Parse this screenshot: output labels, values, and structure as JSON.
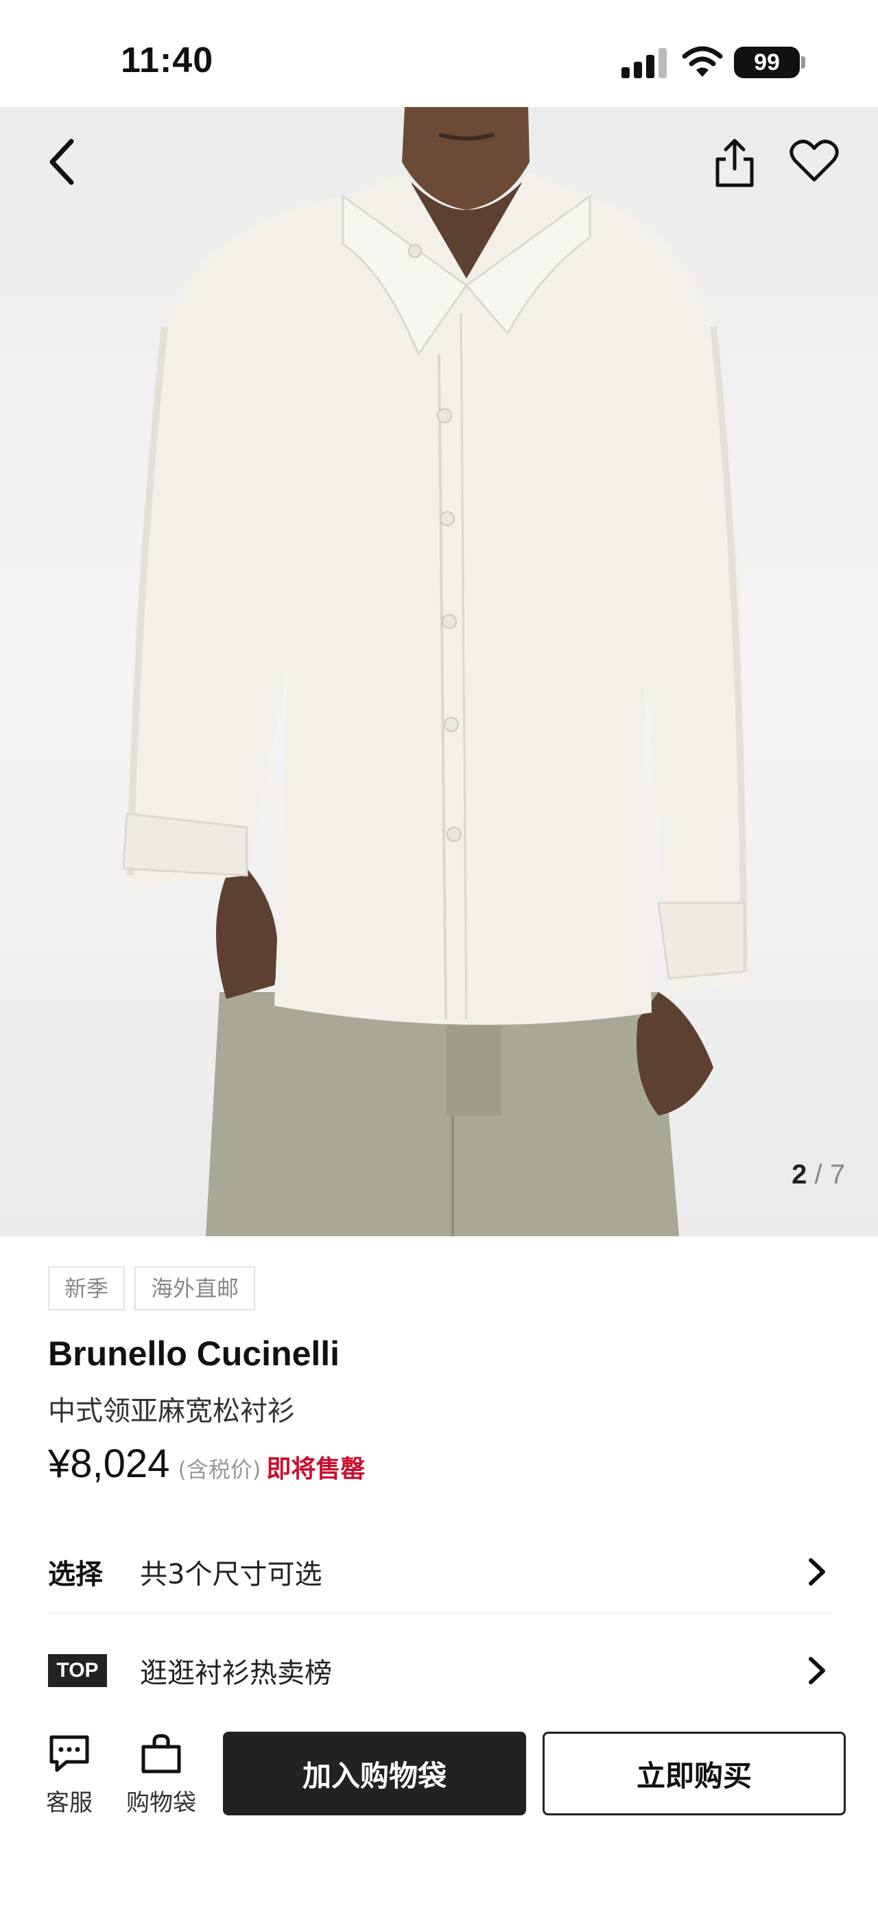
{
  "status_bar": {
    "time": "11:40",
    "battery": "99"
  },
  "gallery": {
    "current": "2",
    "separator": "/",
    "total": "7"
  },
  "product": {
    "tags": [
      "新季",
      "海外直邮"
    ],
    "brand": "Brunello Cucinelli",
    "name": "中式领亚麻宽松衬衫",
    "price": "¥8,024",
    "tax_note": "(含税价)",
    "stock_status": "即将售罄"
  },
  "options": {
    "size_label": "选择",
    "size_text": "共3个尺寸可选",
    "top_badge": "TOP",
    "top_text": "逛逛衬衫热卖榜"
  },
  "bottom_bar": {
    "service_label": "客服",
    "bag_label": "购物袋",
    "add_to_bag": "加入购物袋",
    "buy_now": "立即购买"
  },
  "colors": {
    "accent_red": "#c8102e",
    "primary_dark": "#222222",
    "shirt": "#f3f0ea",
    "trousers": "#a9a896",
    "skin": "#6b4a36"
  },
  "icons": [
    "chevron-left-icon",
    "share-icon",
    "heart-icon",
    "chevron-right-icon",
    "chat-icon",
    "shopping-bag-icon",
    "signal-icon",
    "wifi-icon",
    "battery-icon"
  ]
}
